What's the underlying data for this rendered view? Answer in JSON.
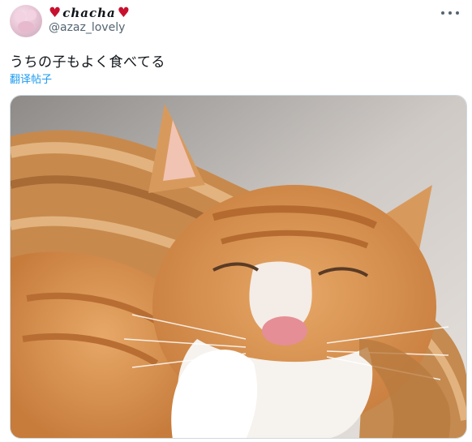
{
  "author": {
    "display_name": "chacha",
    "handle": "@azaz_lovely",
    "name_decoration_icon": "heart-icon",
    "accent_color": "#c8102e"
  },
  "tweet": {
    "text": "うちの子もよく食べてる",
    "translate_label": "翻译帖子",
    "link_color": "#1d9bf0"
  },
  "actions": {
    "more_icon": "more-dots-icon"
  },
  "media": {
    "type": "photo",
    "subject": "cat-photo"
  }
}
